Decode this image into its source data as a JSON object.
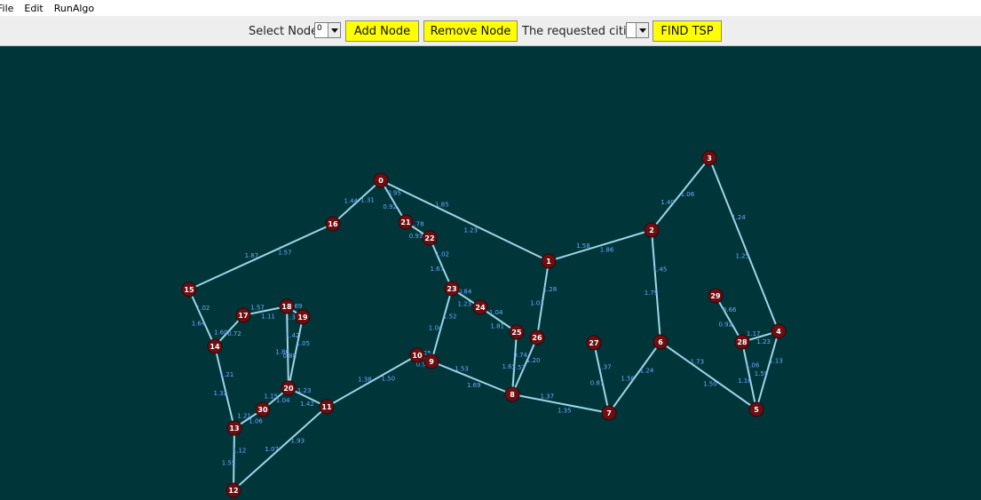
{
  "menu": [
    "File",
    "Edit",
    "RunAlgo"
  ],
  "toolbar": {
    "select_node_label": "Select Node:",
    "select_node_value": "0",
    "add_node_label": "Add Node",
    "remove_node_label": "Remove Node",
    "requested_cities_label": "The requested cities:",
    "requested_cities_value": "",
    "find_tsp_label": "FIND TSP"
  },
  "colors": {
    "canvas_bg": "#00363a",
    "node_fill": "#6b0f12",
    "edge": "#9fd6e8",
    "edge_label": "#6fa8ff",
    "button_bg": "#ffff00"
  },
  "graph": {
    "nodes": [
      "0",
      "1",
      "2",
      "3",
      "4",
      "5",
      "6",
      "7",
      "8",
      "9",
      "10",
      "11",
      "12",
      "13",
      "14",
      "15",
      "16",
      "17",
      "18",
      "19",
      "20",
      "21",
      "22",
      "23",
      "24",
      "25",
      "26",
      "27",
      "28",
      "29",
      "30"
    ],
    "edges": [
      {
        "from": "0",
        "to": "16",
        "weights": [
          "1.31",
          "1.44"
        ]
      },
      {
        "from": "0",
        "to": "21",
        "weights": [
          "0.95",
          "0.92"
        ]
      },
      {
        "from": "0",
        "to": "1",
        "weights": [
          "1.85",
          "1.23"
        ]
      },
      {
        "from": "16",
        "to": "15",
        "weights": [
          "1.57",
          "1.87"
        ]
      },
      {
        "from": "21",
        "to": "22",
        "weights": [
          "1.78",
          "0.93"
        ]
      },
      {
        "from": "22",
        "to": "23",
        "weights": [
          "1.02",
          "1.67"
        ]
      },
      {
        "from": "1",
        "to": "2",
        "weights": [
          "1.58",
          "1.86"
        ]
      },
      {
        "from": "2",
        "to": "3",
        "weights": [
          "1.40",
          "1.06"
        ]
      },
      {
        "from": "3",
        "to": "4",
        "weights": [
          "1.24",
          "1.25"
        ]
      },
      {
        "from": "2",
        "to": "6",
        "weights": [
          "1.45",
          "1.79"
        ]
      },
      {
        "from": "1",
        "to": "26",
        "weights": [
          "1.28",
          "1.03"
        ]
      },
      {
        "from": "23",
        "to": "24",
        "weights": [
          "0.84",
          "1.23"
        ]
      },
      {
        "from": "24",
        "to": "25",
        "weights": [
          "1.04",
          "1.81"
        ]
      },
      {
        "from": "23",
        "to": "9",
        "weights": [
          "1.52",
          "1.04"
        ]
      },
      {
        "from": "25",
        "to": "8",
        "weights": [
          "0.74",
          "1.63"
        ]
      },
      {
        "from": "26",
        "to": "8",
        "weights": [
          "1.20",
          "1.57"
        ]
      },
      {
        "from": "9",
        "to": "8",
        "weights": [
          "1.53",
          "1.69"
        ]
      },
      {
        "from": "8",
        "to": "7",
        "weights": [
          "1.37",
          "1.35"
        ]
      },
      {
        "from": "27",
        "to": "7",
        "weights": [
          "1.37",
          "0.87"
        ]
      },
      {
        "from": "6",
        "to": "7",
        "weights": [
          "1.24",
          "1.58"
        ]
      },
      {
        "from": "6",
        "to": "5",
        "weights": [
          "1.73",
          "1.50"
        ]
      },
      {
        "from": "29",
        "to": "28",
        "weights": [
          "0.66",
          "0.92"
        ]
      },
      {
        "from": "28",
        "to": "4",
        "weights": [
          "1.17",
          "1.23"
        ]
      },
      {
        "from": "28",
        "to": "5",
        "weights": [
          "1.06",
          "1.16"
        ]
      },
      {
        "from": "4",
        "to": "5",
        "weights": [
          "1.13",
          "1.59"
        ]
      },
      {
        "from": "10",
        "to": "11",
        "weights": [
          "1.50",
          "1.38"
        ]
      },
      {
        "from": "10",
        "to": "9",
        "weights": [
          "1.25",
          "0.92"
        ]
      },
      {
        "from": "11",
        "to": "12",
        "weights": [
          "1.93",
          "1.07"
        ]
      },
      {
        "from": "15",
        "to": "14",
        "weights": [
          "1.02",
          "1.64"
        ]
      },
      {
        "from": "14",
        "to": "13",
        "weights": [
          "1.21",
          "1.32"
        ]
      },
      {
        "from": "14",
        "to": "17",
        "weights": [
          "1.60",
          "0.72"
        ]
      },
      {
        "from": "17",
        "to": "18",
        "weights": [
          "1.57",
          "1.11"
        ]
      },
      {
        "from": "18",
        "to": "19",
        "weights": [
          "1.69",
          "1.35"
        ]
      },
      {
        "from": "18",
        "to": "20",
        "weights": [
          "1.42",
          "1.86"
        ]
      },
      {
        "from": "19",
        "to": "20",
        "weights": [
          "1.05",
          "0.88"
        ]
      },
      {
        "from": "20",
        "to": "11",
        "weights": [
          "1.23",
          "1.42"
        ]
      },
      {
        "from": "20",
        "to": "30",
        "weights": [
          "1.04",
          "1.15"
        ]
      },
      {
        "from": "30",
        "to": "13",
        "weights": [
          "1.06",
          "1.21"
        ]
      },
      {
        "from": "13",
        "to": "12",
        "weights": [
          "1.12",
          "1.55"
        ]
      }
    ]
  }
}
